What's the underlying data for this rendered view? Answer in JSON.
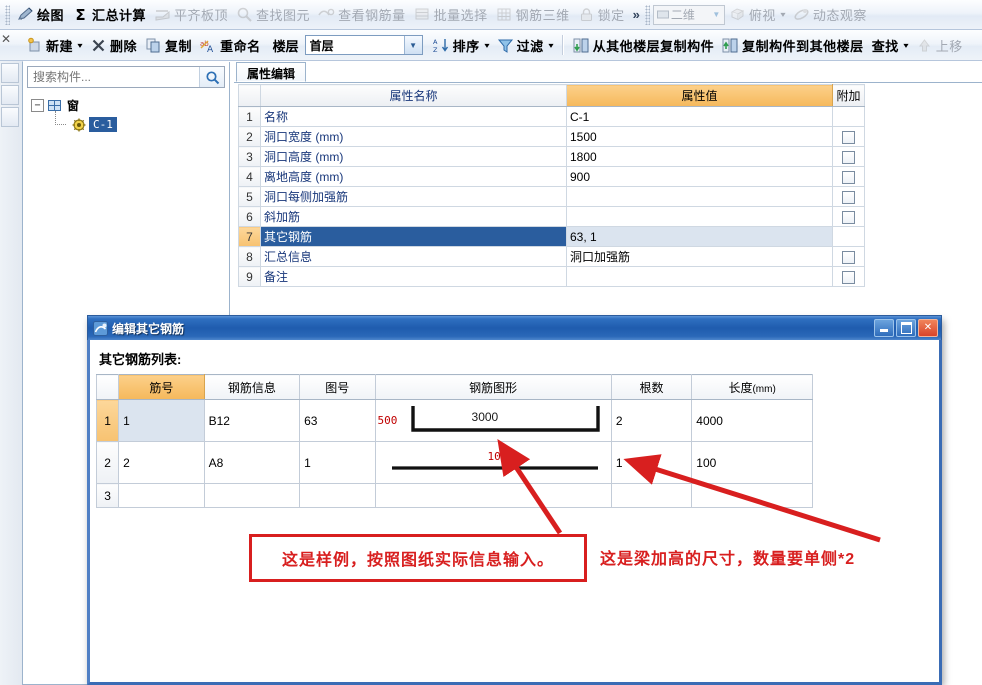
{
  "toolbar_main": {
    "items": [
      {
        "label": "绘图",
        "icon": "pencil-draw-icon",
        "disabled": false
      },
      {
        "label": "汇总计算",
        "icon": "sigma-icon",
        "disabled": false
      },
      {
        "label": "平齐板顶",
        "icon": "align-slab-icon",
        "disabled": true
      },
      {
        "label": "查找图元",
        "icon": "find-element-icon",
        "disabled": true
      },
      {
        "label": "查看钢筋量",
        "icon": "view-rebar-qty-icon",
        "disabled": true
      },
      {
        "label": "批量选择",
        "icon": "batch-select-icon",
        "disabled": true
      },
      {
        "label": "钢筋三维",
        "icon": "rebar-3d-icon",
        "disabled": true
      },
      {
        "label": "锁定",
        "icon": "lock-icon",
        "disabled": true
      }
    ],
    "overflow_label": "»",
    "view_combo": {
      "value": "二维",
      "icon": "two-d-icon"
    },
    "top_view": {
      "label": "俯视",
      "icon": "top-view-icon",
      "disabled": true
    },
    "dynamic_observe": {
      "label": "动态观察",
      "icon": "orbit-icon",
      "disabled": true
    }
  },
  "toolbar_second": {
    "new_label": "新建",
    "delete_label": "删除",
    "copy_label": "复制",
    "rename_label": "重命名",
    "floor_label": "楼层",
    "floor_value": "首层",
    "sort_label": "排序",
    "filter_label": "过滤",
    "copy_from_other_floor": "从其他楼层复制构件",
    "copy_to_other_floor": "复制构件到其他楼层",
    "find_label": "查找",
    "move_up_label": "上移"
  },
  "tree_panel": {
    "search_placeholder": "搜索构件...",
    "search_value": "",
    "root_label": "窗",
    "child_label": "C-1",
    "expander_glyph": "−"
  },
  "property_panel": {
    "tab_label": "属性编辑",
    "headers": {
      "index": "",
      "name": "属性名称",
      "value": "属性值",
      "attach": "附加"
    },
    "rows": [
      {
        "index": "1",
        "name": "名称",
        "value": "C-1",
        "attach": false,
        "selected": false
      },
      {
        "index": "2",
        "name": "洞口宽度 (mm)",
        "value": "1500",
        "attach": true,
        "selected": false
      },
      {
        "index": "3",
        "name": "洞口高度 (mm)",
        "value": "1800",
        "attach": true,
        "selected": false
      },
      {
        "index": "4",
        "name": "离地高度 (mm)",
        "value": "900",
        "attach": true,
        "selected": false
      },
      {
        "index": "5",
        "name": "洞口每侧加强筋",
        "value": "",
        "attach": true,
        "selected": false
      },
      {
        "index": "6",
        "name": "斜加筋",
        "value": "",
        "attach": true,
        "selected": false
      },
      {
        "index": "7",
        "name": "其它钢筋",
        "value": "63, 1",
        "attach": false,
        "selected": true
      },
      {
        "index": "8",
        "name": "汇总信息",
        "value": "洞口加强筋",
        "attach": true,
        "selected": false
      },
      {
        "index": "9",
        "name": "备注",
        "value": "",
        "attach": true,
        "selected": false
      }
    ]
  },
  "dialog": {
    "title": "编辑其它钢筋",
    "icon": "app-window-icon",
    "list_label": "其它钢筋列表:",
    "minimize_title": "最小化",
    "maximize_title": "最大化",
    "close_title": "关闭",
    "headers": {
      "index": "",
      "no": "筋号",
      "info": "钢筋信息",
      "tu": "图号",
      "shape": "钢筋图形",
      "count": "根数",
      "length": "长度",
      "length_unit": "(mm)"
    },
    "rows": [
      {
        "index": "1",
        "no": "1",
        "info": "B12",
        "tu": "63",
        "shape_type": "u-bracket",
        "shape_left_dim": "500",
        "shape_mid_dim": "3000",
        "count": "2",
        "length": "4000",
        "selected": true
      },
      {
        "index": "2",
        "no": "2",
        "info": "A8",
        "tu": "1",
        "shape_type": "straight-line",
        "shape_left_dim": "",
        "shape_mid_dim": "100",
        "count": "1",
        "length": "100",
        "selected": false
      },
      {
        "index": "3",
        "no": "",
        "info": "",
        "tu": "",
        "shape_type": "",
        "shape_left_dim": "",
        "shape_mid_dim": "",
        "count": "",
        "length": "",
        "selected": false
      }
    ]
  },
  "annotations": {
    "note1": "这是样例，按照图纸实际信息输入。",
    "note2": "这是梁加高的尺寸，数量要单侧*2",
    "color": "#d81f1f"
  },
  "colors": {
    "accent_orange": "#f5b85b",
    "selection_blue": "#2a5d9e",
    "title_blue": "#1f5cae",
    "annotation_red": "#d81f1f",
    "dim_red": "#c00000",
    "prop_name_text": "#17367a"
  }
}
